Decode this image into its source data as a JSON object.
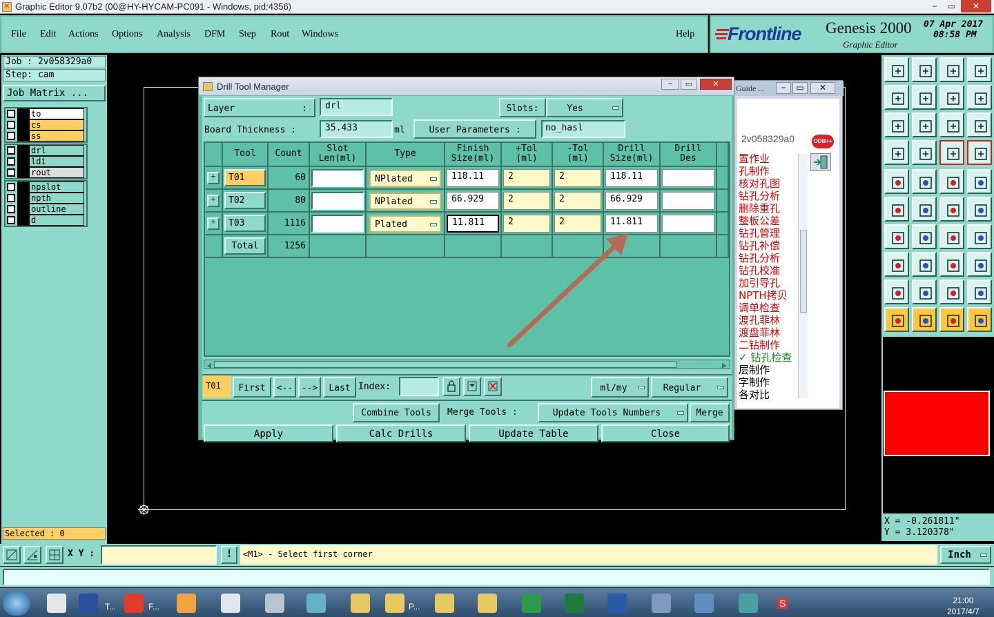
{
  "window": {
    "title": "Graphic Editor 9.07b2 (00@HY-HYCAM-PC091 - Windows, pid:4356)",
    "minimize": "−",
    "maximize": "▭",
    "close": "✕"
  },
  "menu": {
    "items": [
      "File",
      "Edit",
      "Actions",
      "Options",
      "Analysis",
      "DFM",
      "Step",
      "Rout",
      "Windows"
    ],
    "help": "Help"
  },
  "brand": {
    "logo": "Frontline",
    "product": "Genesis 2000",
    "subtitle": "Graphic Editor",
    "date": "07 Apr 2017",
    "time": "08:58 PM"
  },
  "left_panel": {
    "job_label": "Job : 2v058329a0",
    "step_label": "Step: cam",
    "job_matrix_button": "Job Matrix ...",
    "layers_group1": [
      {
        "name": "to",
        "color": "#ffffff"
      },
      {
        "name": "cs",
        "color": "#ffd060"
      },
      {
        "name": "ss",
        "color": "#ffd060"
      }
    ],
    "layers_group2": [
      {
        "name": "drl",
        "color": "#8ed9c9"
      },
      {
        "name": "ldi",
        "color": "#8ed9c9"
      },
      {
        "name": "rout",
        "color": "#dddddd"
      }
    ],
    "layers_group3": [
      {
        "name": "npslot",
        "color": "#8ed9c9"
      },
      {
        "name": "npth",
        "color": "#8ed9c9"
      },
      {
        "name": "outline",
        "color": "#8ed9c9"
      },
      {
        "name": "d",
        "color": "#8ed9c9"
      }
    ],
    "selected": "Selected : 0"
  },
  "guide_window": {
    "title": "Guide ...",
    "job": "2v058329a0",
    "odb_button": "ODB++",
    "items_red": [
      "置作业",
      "孔制作",
      "核对孔图",
      "钻孔分析",
      "删除重孔",
      "整板公差",
      "钻孔管理",
      "钻孔补偿",
      "钻孔分析",
      "钻孔校准",
      "加引导孔",
      "NPTH拷贝",
      "调单检查",
      "渡孔菲林",
      "渡盘菲林",
      "二钻制作"
    ],
    "item_checked": "✓ 钻孔检查",
    "items_black": [
      "层制作",
      "字制作",
      "各对比"
    ]
  },
  "dialog": {
    "title": "Drill Tool Manager",
    "layer_label": "Layer",
    "layer_colon": ":",
    "layer_value": "drl",
    "slots_label": "Slots:",
    "slots_value": "Yes",
    "board_thickness_label": "Board Thickness :",
    "board_thickness_value": "35.433",
    "board_thickness_unit": "ml",
    "user_params_button": "User Parameters :",
    "user_params_value": "no_hasl",
    "columns": {
      "tool": "Tool",
      "count": "Count",
      "slot_len_1": "Slot",
      "slot_len_2": "Len(ml)",
      "type": "Type",
      "finish_1": "Finish",
      "finish_2": "Size(ml)",
      "ptol_1": "+Tol",
      "ptol_2": "(ml)",
      "mtol_1": "-Tol",
      "mtol_2": "(ml)",
      "drill_1": "Drill",
      "drill_2": "Size(ml)",
      "des_1": "Drill",
      "des_2": "Des"
    },
    "rows": [
      {
        "tool": "T01",
        "count": "60",
        "type": "NPlated",
        "finish": "118.11",
        "ptol": "2",
        "mtol": "2",
        "drill": "118.11"
      },
      {
        "tool": "T02",
        "count": "80",
        "type": "NPlated",
        "finish": "66.929",
        "ptol": "2",
        "mtol": "2",
        "drill": "66.929"
      },
      {
        "tool": "T03",
        "count": "1116",
        "type": "Plated",
        "finish": "11.811",
        "ptol": "2",
        "mtol": "2",
        "drill": "11.811"
      }
    ],
    "total_label": "Total",
    "total_value": "1256",
    "nav": {
      "current": "T01",
      "first": "First",
      "prev": "<--",
      "next": "-->",
      "last": "Last",
      "index_label": "Index:",
      "units": "ml/my",
      "mode": "Regular"
    },
    "actions": {
      "combine": "Combine Tools",
      "merge_label": "Merge Tools :",
      "merge_option": "Update Tools Numbers",
      "merge": "Merge",
      "apply": "Apply",
      "calc": "Calc Drills",
      "update": "Update Table",
      "close": "Close"
    }
  },
  "coords": {
    "x": "X = -0.261811\"",
    "y": "Y = 3.120378\""
  },
  "status": {
    "xy_label": "X Y :",
    "message": "<M1> - Select first corner",
    "units": "Inch"
  },
  "taskbar": {
    "labels": [
      "T...",
      "F...",
      "P..."
    ],
    "time": "21:00",
    "date": "2017/4/7"
  },
  "colors": {
    "panel": "#8ed9c9",
    "accent": "#ffd060",
    "selected_preview": "#ff0000",
    "guide_text": "#dd0000"
  }
}
